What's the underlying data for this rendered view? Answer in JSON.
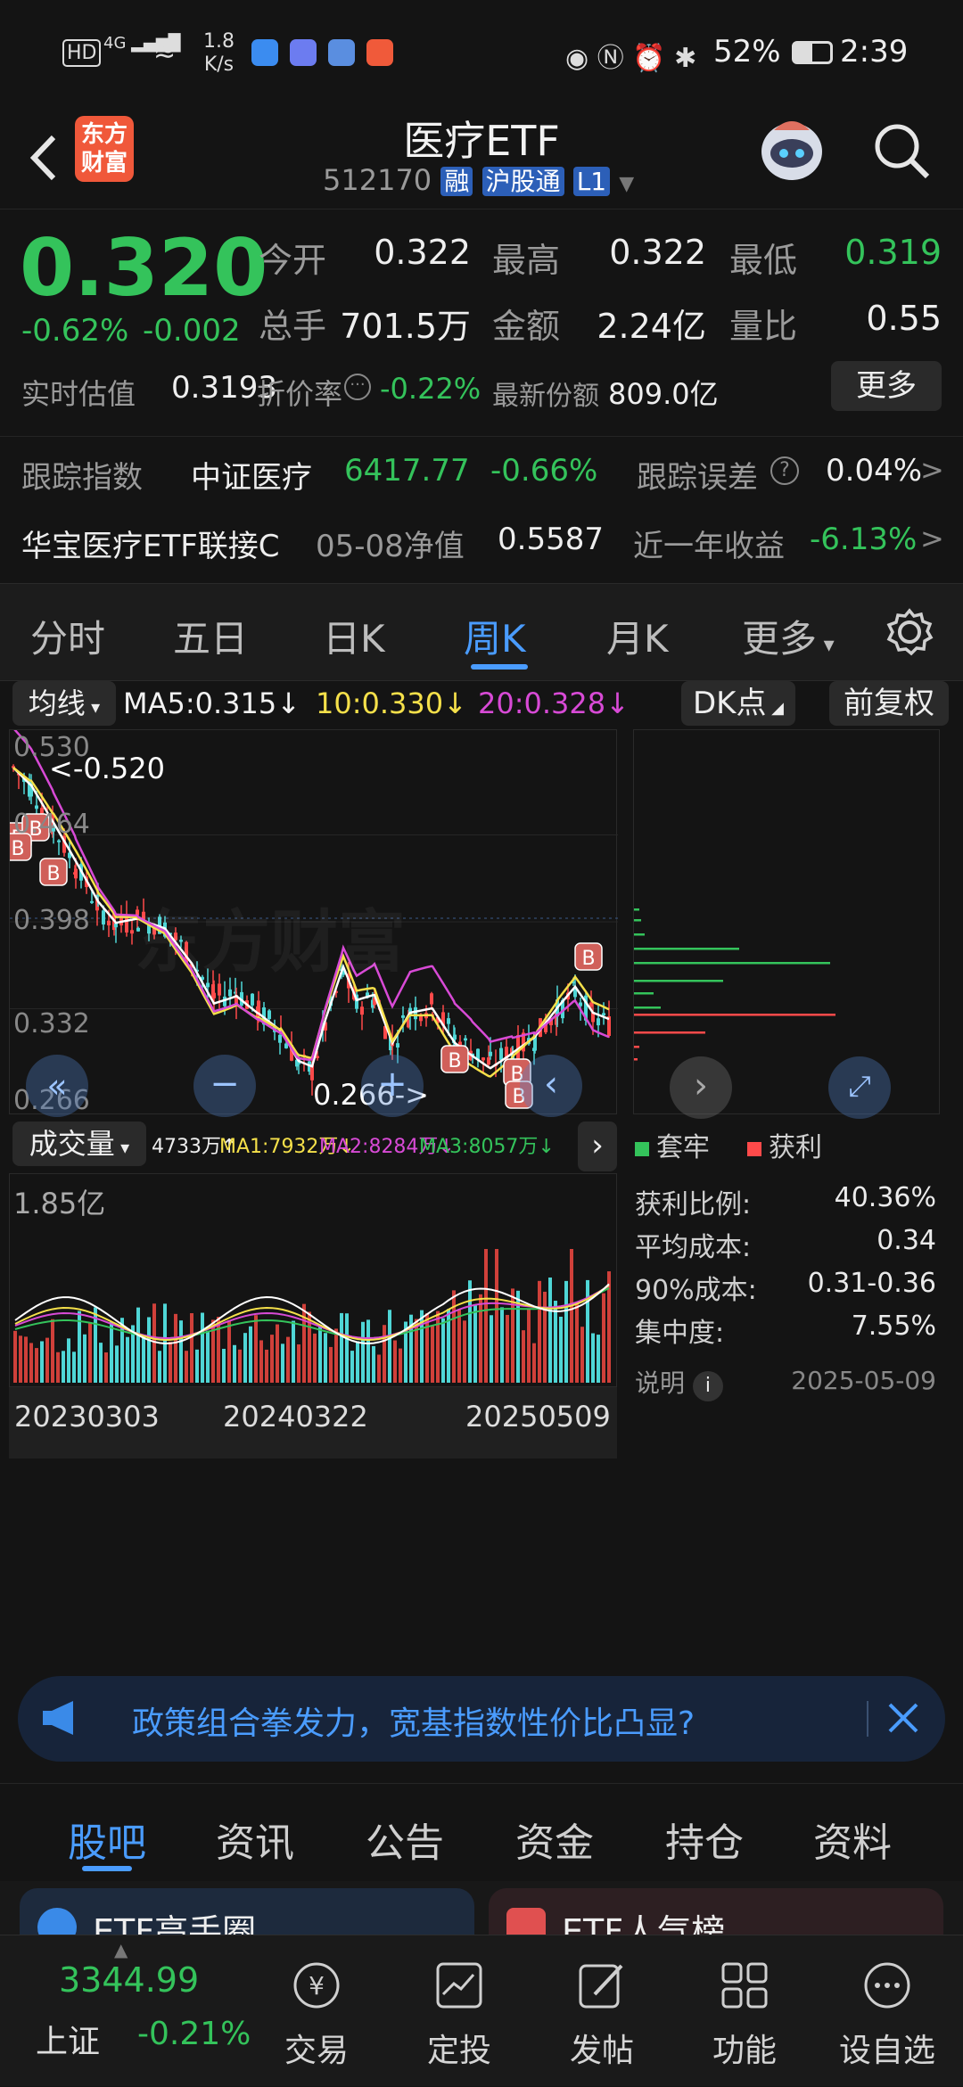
{
  "status": {
    "time": "2:39",
    "battery": "52%",
    "speed_top": "1.8",
    "speed_unit": "K/s",
    "net": "4G"
  },
  "header": {
    "title": "医疗ETF",
    "code": "512170",
    "tag_rong": "融",
    "tag_hgt": "沪股通",
    "tag_l1": "L1",
    "logo_line1": "东方",
    "logo_line2": "财富"
  },
  "quote": {
    "price": "0.320",
    "change_pct": "-0.62%",
    "change": "-0.002",
    "open_label": "今开",
    "open": "0.322",
    "high_label": "最高",
    "high": "0.322",
    "low_label": "最低",
    "low": "0.319",
    "vol_label": "总手",
    "vol": "701.5万",
    "amt_label": "金额",
    "amt": "2.24亿",
    "ratio_label": "量比",
    "ratio": "0.55",
    "iopv_label": "实时估值",
    "iopv": "0.3193",
    "disc_label": "折价率",
    "disc": "-0.22%",
    "shares_label": "最新份额",
    "shares": "809.0亿",
    "more": "更多",
    "track_label": "跟踪指数",
    "track_name": "中证医疗",
    "track_val": "6417.77",
    "track_pct": "-0.66%",
    "err_label": "跟踪误差",
    "err_val": "0.04%",
    "fund_name": "华宝医疗ETF联接C",
    "nav_label": "05-08净值",
    "nav": "0.5587",
    "year_label": "近一年收益",
    "year_val": "-6.13%"
  },
  "tabs": [
    "分时",
    "五日",
    "日K",
    "周K",
    "月K",
    "更多"
  ],
  "active_tab": "周K",
  "ma_bar": {
    "type": "均线",
    "ma5": "MA5:0.315",
    "ma10": "10:0.330",
    "ma20": "20:0.328",
    "dk": "DK点",
    "fq": "前复权"
  },
  "price_axis": [
    "0.530",
    "0.464",
    "0.398",
    "0.332",
    "0.266"
  ],
  "annot_high": "<-0.520",
  "annot_low": "0.266->",
  "watermark": "东方财富",
  "vol_bar": {
    "label": "成交量",
    "v": "4733万",
    "ma1": "MA1:7932万",
    "ma2": "MA2:8284万",
    "ma3": "MA3:8057万",
    "axis_top": "1.85亿"
  },
  "dates": [
    "20230303",
    "20240322",
    "20250509"
  ],
  "chips": {
    "legend_hold": "套牢",
    "legend_profit": "获利",
    "rows": [
      {
        "k": "获利比例:",
        "v": "40.36%"
      },
      {
        "k": "平均成本:",
        "v": "0.34"
      },
      {
        "k": "90%成本:",
        "v": "0.31-0.36"
      },
      {
        "k": "集中度:",
        "v": "7.55%"
      }
    ],
    "note": "说明",
    "date": "2025-05-09"
  },
  "banner": "政策组合拳发力，宽基指数性价比凸显?",
  "subtabs": [
    "股吧",
    "资讯",
    "公告",
    "资金",
    "持仓",
    "资料"
  ],
  "cards": [
    "ETF高手圈",
    "ETF人气榜"
  ],
  "bottom": {
    "index_val": "3344.99",
    "index_name": "上证",
    "index_pct": "-0.21%",
    "items": [
      "交易",
      "定投",
      "发帖",
      "功能",
      "设自选"
    ]
  },
  "chart_data": {
    "type": "candlestick",
    "ylim": [
      0.266,
      0.53
    ],
    "high": 0.52,
    "low": 0.266,
    "last": 0.32,
    "ma5": 0.315,
    "ma10": 0.33,
    "ma20": 0.328
  }
}
